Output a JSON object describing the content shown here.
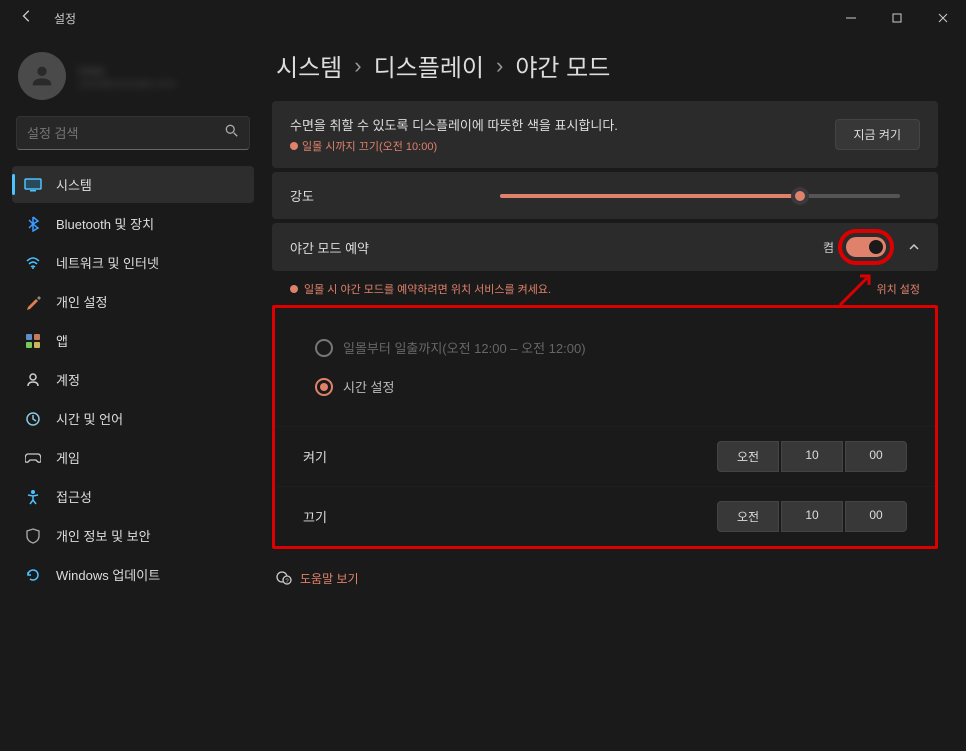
{
  "titlebar": {
    "title": "설정"
  },
  "user": {
    "name": "User",
    "email": "user@example.com"
  },
  "search": {
    "placeholder": "설정 검색"
  },
  "nav": {
    "items": [
      {
        "label": "시스템",
        "icon": "system"
      },
      {
        "label": "Bluetooth 및 장치",
        "icon": "bluetooth"
      },
      {
        "label": "네트워크 및 인터넷",
        "icon": "network"
      },
      {
        "label": "개인 설정",
        "icon": "personalization"
      },
      {
        "label": "앱",
        "icon": "apps"
      },
      {
        "label": "계정",
        "icon": "accounts"
      },
      {
        "label": "시간 및 언어",
        "icon": "time"
      },
      {
        "label": "게임",
        "icon": "gaming"
      },
      {
        "label": "접근성",
        "icon": "accessibility"
      },
      {
        "label": "개인 정보 및 보안",
        "icon": "privacy"
      },
      {
        "label": "Windows 업데이트",
        "icon": "update"
      }
    ]
  },
  "breadcrumb": [
    "시스템",
    "디스플레이",
    "야간 모드"
  ],
  "panel": {
    "desc": "수면을 취할 수 있도록 디스플레이에 따뜻한 색을 표시합니다.",
    "desc_sub": "일몰 시까지 끄기(오전 10:00)",
    "turn_on_now": "지금 켜기",
    "strength": "강도",
    "schedule_label": "야간 모드 예약",
    "schedule_toggle_label": "켬",
    "warn_text": "일몰 시 야간 모드를 예약하려면 위치 서비스를 켜세요.",
    "location_link": "위치 설정",
    "radio_sunset": "일몰부터 일출까지(오전 12:00 – 오전 12:00)",
    "radio_custom": "시간 설정",
    "on_label": "켜기",
    "off_label": "끄기",
    "time_on": {
      "ampm": "오전",
      "hour": "10",
      "min": "00"
    },
    "time_off": {
      "ampm": "오전",
      "hour": "10",
      "min": "00"
    },
    "help": "도움말 보기"
  }
}
